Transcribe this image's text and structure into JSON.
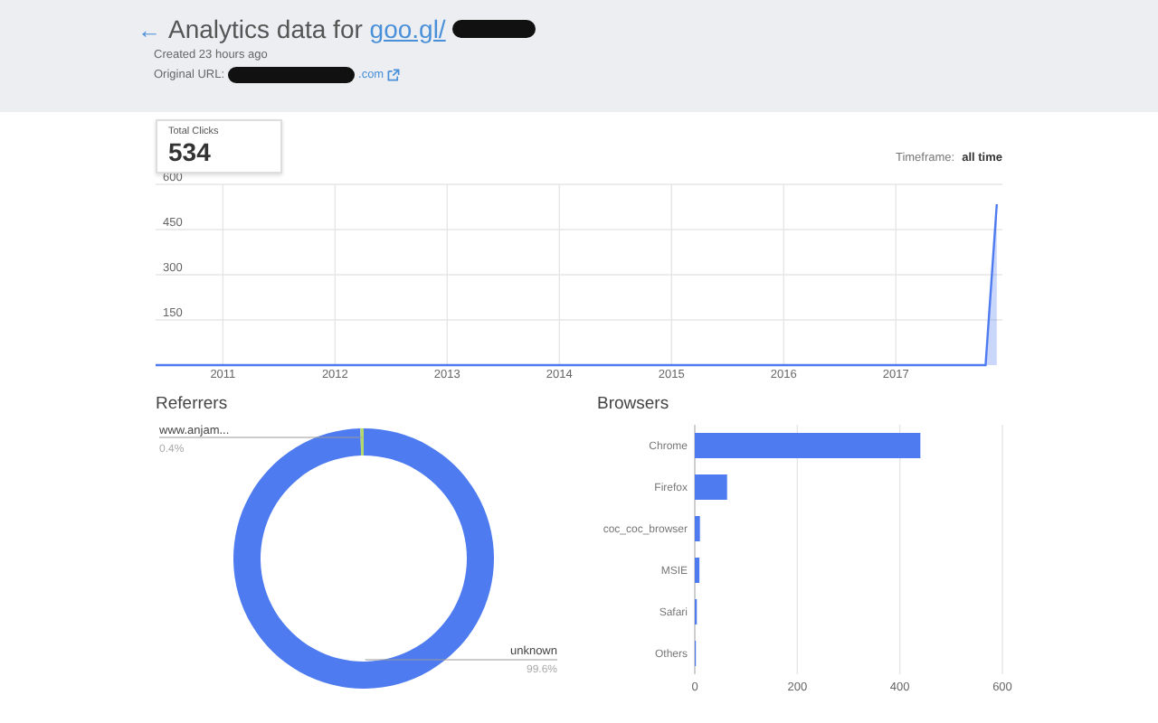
{
  "header": {
    "back_icon": "←",
    "title": "Analytics data for ",
    "short_link": "goo.gl/",
    "created": "Created 23 hours ago",
    "original_url_label": "Original URL:",
    "original_url_tail": ".com"
  },
  "clicks": {
    "label": "Total Clicks",
    "value": "534",
    "timeframe_label": "Timeframe:",
    "timeframe_value": "all time",
    "chart_data": {
      "type": "area",
      "x": [
        2010.4,
        2017.8,
        2017.9
      ],
      "grid": true,
      "series": [
        {
          "color": "#4e7bf0",
          "values": [
            0,
            0,
            534
          ]
        }
      ],
      "xlim": [
        2010.4,
        2017.95
      ],
      "ylim": [
        0,
        600
      ],
      "xticks": [
        2011,
        2012,
        2013,
        2014,
        2015,
        2016,
        2017
      ],
      "yticks": [
        150,
        300,
        450,
        600
      ]
    }
  },
  "referrers": {
    "title": "Referrers",
    "chart_data": {
      "type": "donut",
      "categories": [
        "unknown",
        "www.anjam..."
      ],
      "series": [
        {
          "values": [
            99.6,
            0.4
          ]
        }
      ],
      "value_labels": [
        "99.6%",
        "0.4%"
      ],
      "colors": [
        "#4e7bf0",
        "#b5d86a"
      ]
    }
  },
  "browsers": {
    "title": "Browsers",
    "chart_data": {
      "type": "bar",
      "orientation": "horizontal",
      "categories": [
        "Chrome",
        "Firefox",
        "coc_coc_browser",
        "MSIE",
        "Safari",
        "Others"
      ],
      "series": [
        {
          "color": "#4e7bf0",
          "values": [
            440,
            63,
            10,
            9,
            4,
            1
          ]
        }
      ],
      "xlim": [
        0,
        600
      ],
      "xticks": [
        0,
        200,
        400,
        600
      ]
    }
  }
}
